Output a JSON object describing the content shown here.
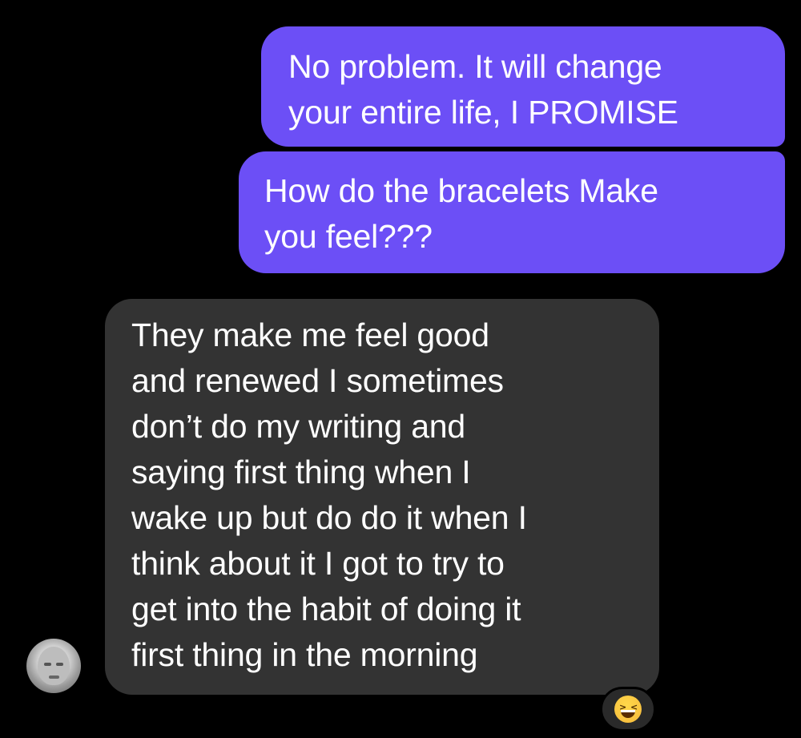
{
  "conversation": {
    "messages": [
      {
        "direction": "sent",
        "text": "No problem. It will change\nyour entire life, I PROMISE"
      },
      {
        "direction": "sent",
        "text": "How do the bracelets Make\nyou feel???"
      },
      {
        "direction": "received",
        "text": "They make me feel good\nand renewed I sometimes\ndon’t do my writing and\nsaying first thing when I\nwake up but do do it when I\nthink about it I got to try to\nget into the habit of doing it\nfirst thing in the morning",
        "reaction": "laughing-emoji"
      }
    ]
  },
  "colors": {
    "background": "#000000",
    "sent_bubble": "#6c4ff6",
    "received_bubble": "#333333",
    "text": "#ffffff"
  },
  "icons": {
    "avatar": "user-avatar",
    "reaction": "grinning-squinting-face-icon"
  }
}
